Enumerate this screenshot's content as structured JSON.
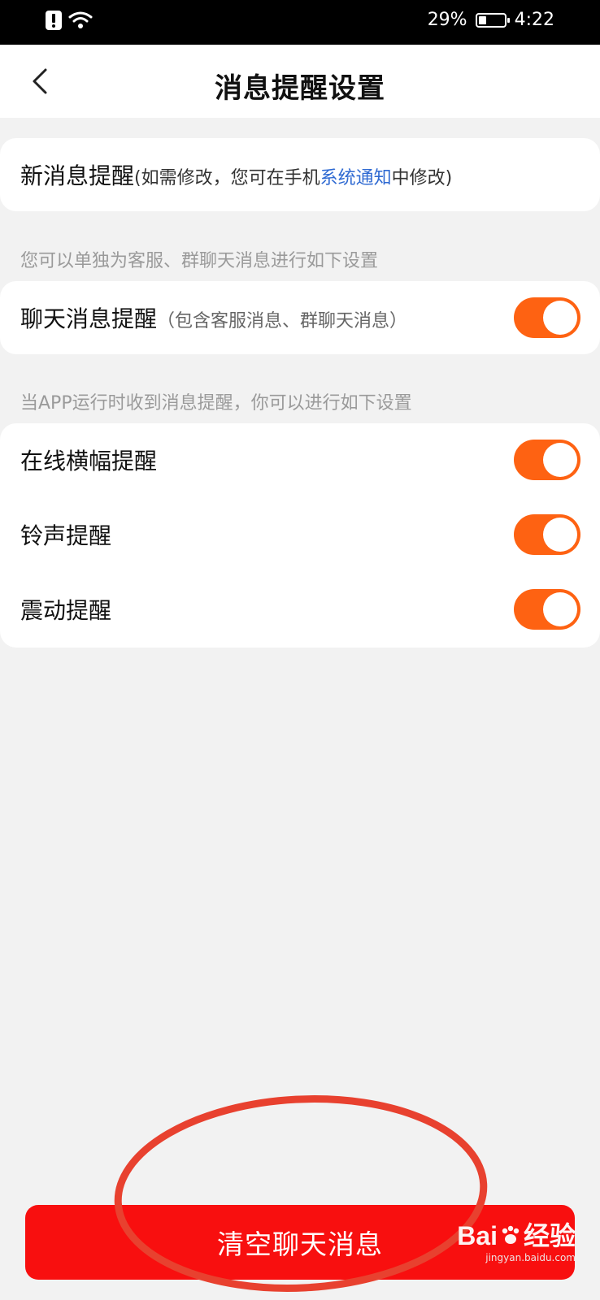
{
  "status_bar": {
    "battery_percent": "29%",
    "battery_level": 0.29,
    "time": "4:22"
  },
  "header": {
    "title": "消息提醒设置"
  },
  "card_new_message": {
    "label": "新消息提醒",
    "hint_prefix": "(如需修改，您可在手机",
    "hint_link": "系统通知",
    "hint_suffix": "中修改)"
  },
  "note_1": "您可以单独为客服、群聊天消息进行如下设置",
  "card_chat": {
    "label": "聊天消息提醒",
    "hint": "（包含客服消息、群聊天消息）",
    "enabled": true
  },
  "note_2": "当APP运行时收到消息提醒，你可以进行如下设置",
  "card_app": {
    "items": [
      {
        "label": "在线横幅提醒",
        "enabled": true
      },
      {
        "label": "铃声提醒",
        "enabled": true
      },
      {
        "label": "震动提醒",
        "enabled": true
      }
    ]
  },
  "bottom": {
    "clear_button_label": "清空聊天消息"
  },
  "watermark": {
    "brand": "Bai",
    "brand_suffix": "经验",
    "sub": "jingyan.baidu.com"
  },
  "colors": {
    "accent_toggle": "#fe6212",
    "danger_button": "#f80f0f",
    "link": "#2f6ad2",
    "annotation": "#e8412f"
  }
}
